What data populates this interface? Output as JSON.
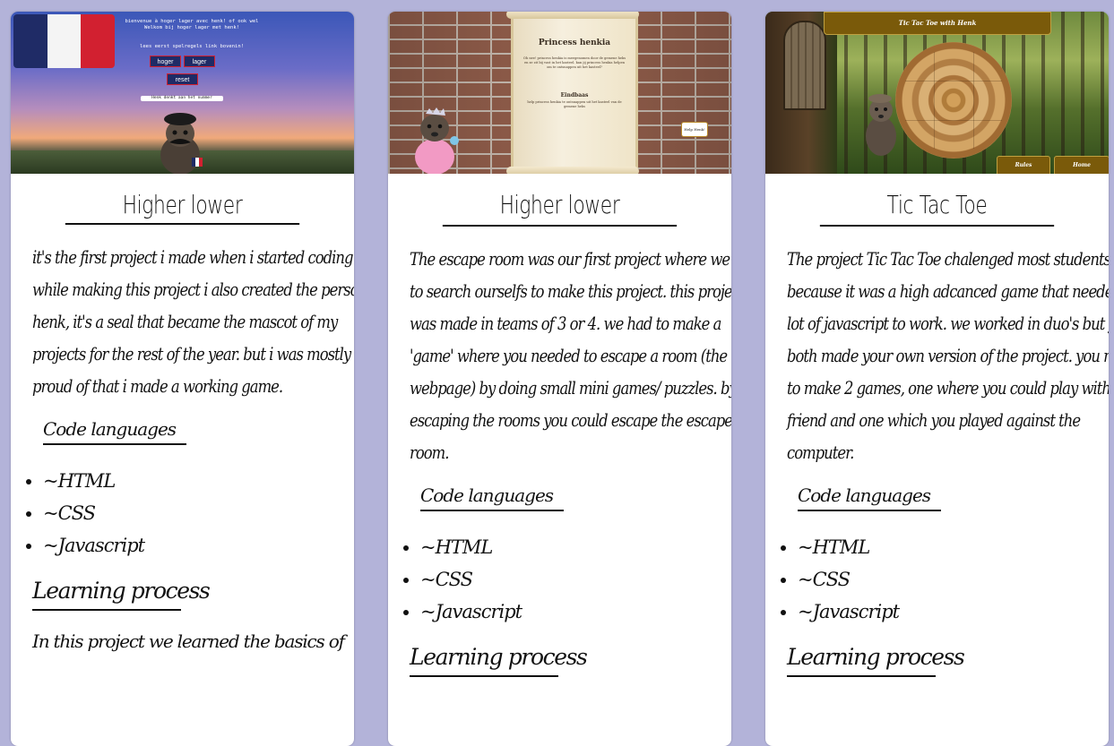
{
  "cards": [
    {
      "thumb": {
        "welcome": "bienvenue à hoger lager avec henk!\nof ook wel Welkom bij hoger lager met henk!",
        "rules_link": "lees eerst spelregels link bovenin!",
        "buttons": [
          "hoger",
          "lager",
          "reset"
        ],
        "info_bar": "Henk denkt aan het nummer"
      },
      "title": "Higher lower",
      "description": "it's the first project i made when i started coding. while making this project i also created the persona henk, it's a seal that became the mascot of my projects for the rest of the year. but i was mostly proud of that i made a working game.",
      "code_heading": "Code languages",
      "languages": [
        "~HTML",
        "~CSS",
        "~Javascript"
      ],
      "learning_heading": "Learning process",
      "learning_text": "In this project we learned the basics of"
    },
    {
      "thumb": {
        "scroll_title": "Princess henkia",
        "scroll_text": "Oh nee! princess henkia is meegenomen door de gemene heks en ze zit bij vast in het kasteel. kan jij princess henkia helpen om te ontsnappen uit het kasteel?",
        "end_heading": "Eindbaas",
        "end_text": "help princess henkia te ontsnappen uit het kasteel van de gemene heks",
        "help_button": "Help Henk!"
      },
      "title": "Higher lower",
      "description": "The escape room was our first project where we had to search ourselfs to make this project. this project was made in teams of 3 or 4. we had to make a 'game' where you needed to escape a room (the webpage) by doing small mini games/ puzzles. by escaping the rooms you could escape the escape room.",
      "code_heading": "Code languages",
      "languages": [
        "~HTML",
        "~CSS",
        "~Javascript"
      ],
      "learning_heading": "Learning process"
    },
    {
      "thumb": {
        "banner": "Tic Tac Toe with Henk",
        "rules_button": "Rules",
        "home_button": "Home"
      },
      "title": "Tic Tac Toe",
      "description": "The project Tic Tac Toe chalenged most students because it was a high adcanced game that needed a lot of javascript to work. we worked in duo's but you both made your own version of the project. you need to make 2 games, one where you could play with a friend and one which you played against the computer.",
      "code_heading": "Code languages",
      "languages": [
        "~HTML",
        "~CSS",
        "~Javascript"
      ],
      "learning_heading": "Learning process"
    }
  ],
  "colors": {
    "page_background": "#b3b3d9",
    "card_background": "#ffffff",
    "text": "#111111",
    "flag_blue": "#1f2b66",
    "flag_red": "#d22030",
    "banner_brown": "#7a5a0a"
  }
}
